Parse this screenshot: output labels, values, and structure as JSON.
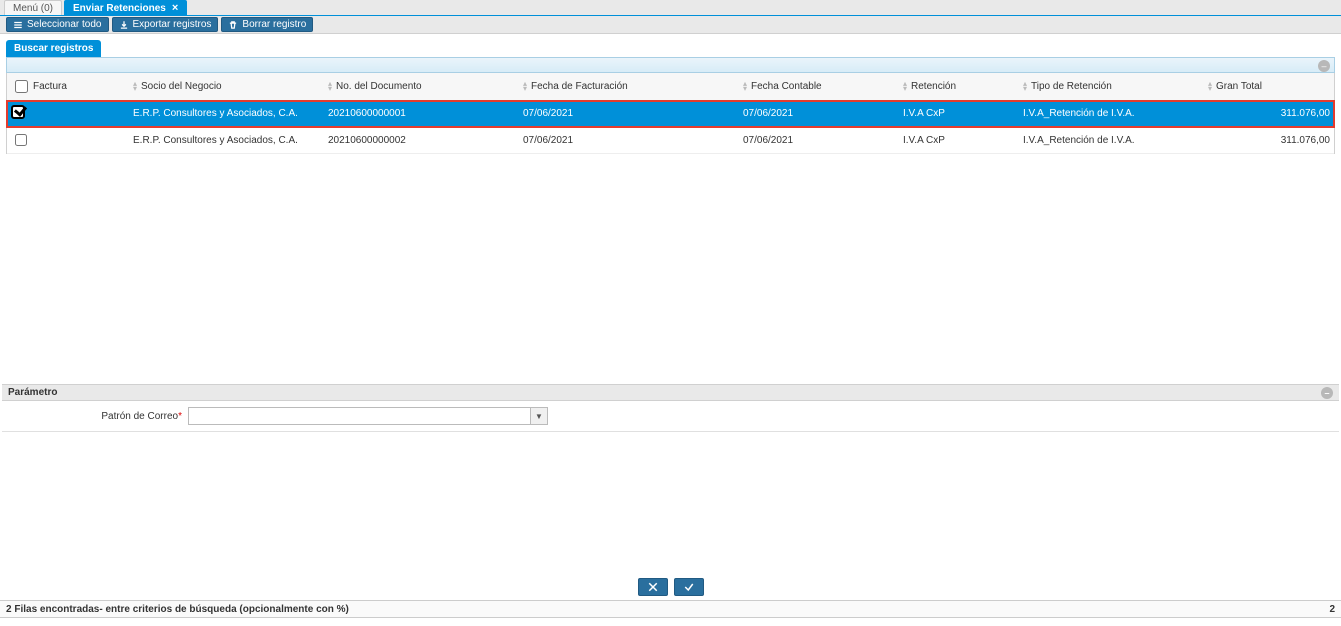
{
  "tabs": {
    "menu": "Menú (0)",
    "active": "Enviar Retenciones"
  },
  "toolbar": {
    "select_all": "Seleccionar todo",
    "export": "Exportar registros",
    "delete": "Borrar registro"
  },
  "search": {
    "label": "Buscar registros"
  },
  "table": {
    "headers": {
      "factura": "Factura",
      "socio": "Socio del Negocio",
      "docno": "No. del Documento",
      "fecha_fact": "Fecha de Facturación",
      "fecha_cont": "Fecha Contable",
      "retencion": "Retención",
      "tipo_ret": "Tipo de Retención",
      "gran_total": "Gran Total"
    },
    "rows": [
      {
        "checked": true,
        "selected": true,
        "highlight": true,
        "socio": "E.R.P. Consultores y Asociados, C.A.",
        "docno": "20210600000001",
        "fecha_fact": "07/06/2021",
        "fecha_cont": "07/06/2021",
        "retencion": "I.V.A CxP",
        "tipo_ret": "I.V.A_Retención de I.V.A.",
        "gran_total": "311.076,00"
      },
      {
        "checked": false,
        "selected": false,
        "highlight": false,
        "socio": "E.R.P. Consultores y Asociados, C.A.",
        "docno": "20210600000002",
        "fecha_fact": "07/06/2021",
        "fecha_cont": "07/06/2021",
        "retencion": "I.V.A CxP",
        "tipo_ret": "I.V.A_Retención de I.V.A.",
        "gran_total": "311.076,00"
      }
    ]
  },
  "param": {
    "section_title": "Parámetro",
    "mail_pattern_label": "Patrón de Correo",
    "mail_pattern_value": ""
  },
  "status": {
    "left": "2 Filas encontradas- entre criterios de búsqueda (opcionalmente con %)",
    "right": "2"
  }
}
